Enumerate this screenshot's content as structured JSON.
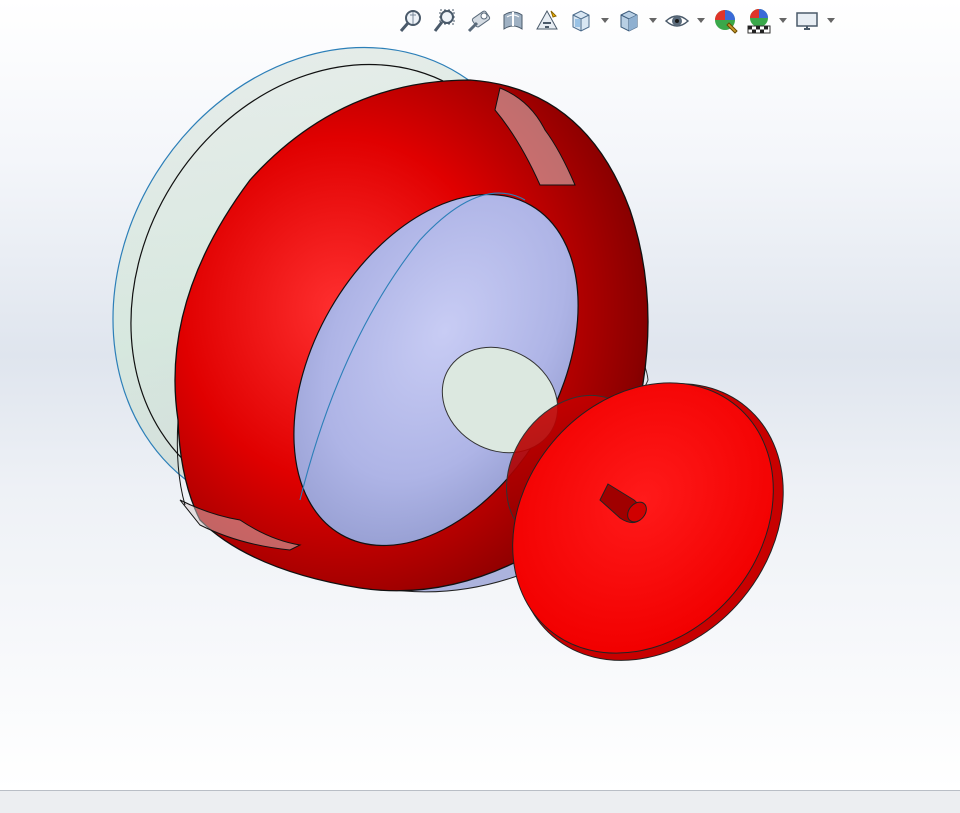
{
  "app": {
    "window_kind": "3D CAD model viewport",
    "model_color": "#ff0000",
    "background_top": "#ffffff",
    "background_band": "#dfe5ee"
  },
  "hud_toolbar": {
    "items": [
      {
        "name": "zoom-to-fit",
        "icon": "zoom-fit-icon"
      },
      {
        "name": "zoom-to-area",
        "icon": "zoom-area-icon"
      },
      {
        "name": "previous-view",
        "icon": "previous-view-icon"
      },
      {
        "name": "section-view",
        "icon": "section-view-icon"
      },
      {
        "name": "dynamic-annotation-views",
        "icon": "annotation-views-icon"
      },
      {
        "name": "view-orientation",
        "icon": "view-orientation-icon",
        "has_dropdown": true
      },
      {
        "name": "display-style",
        "icon": "display-style-icon",
        "has_dropdown": true
      },
      {
        "name": "hide-show-items",
        "icon": "eye-icon",
        "has_dropdown": true
      },
      {
        "name": "edit-appearance",
        "icon": "appearance-icon"
      },
      {
        "name": "apply-scene",
        "icon": "scene-icon",
        "has_dropdown": true
      },
      {
        "name": "view-settings",
        "icon": "monitor-icon",
        "has_dropdown": true
      }
    ]
  }
}
